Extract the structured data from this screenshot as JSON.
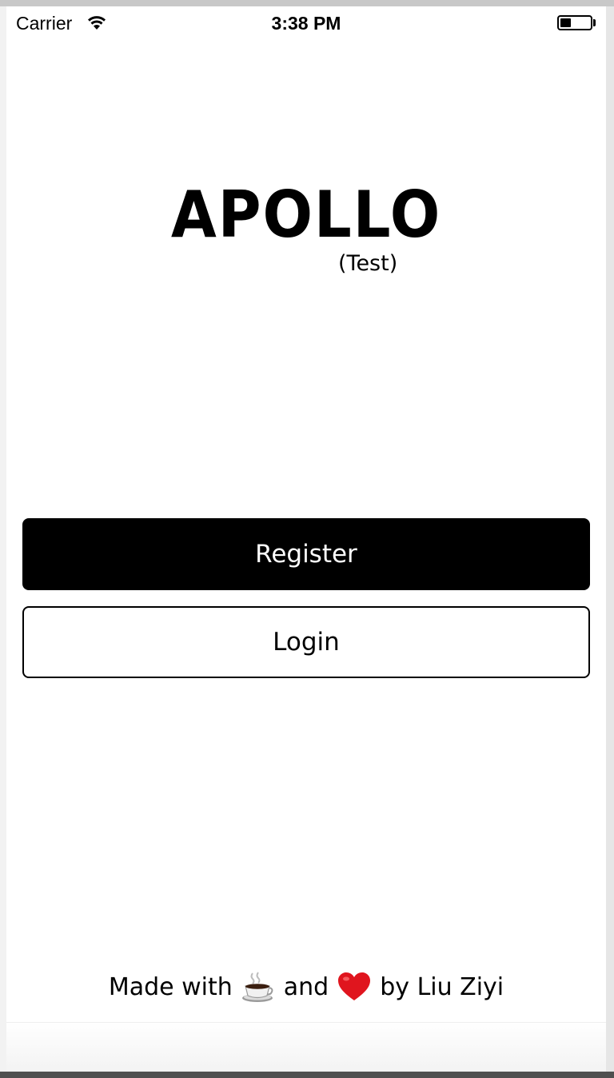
{
  "status_bar": {
    "carrier": "Carrier",
    "time": "3:38 PM",
    "battery_level_fraction": 0.35
  },
  "logo": {
    "title": "APOLLO",
    "subtitle": "(Test)"
  },
  "actions": {
    "register_label": "Register",
    "login_label": "Login"
  },
  "footer": {
    "made_with": "Made with",
    "coffee_icon": "coffee-icon",
    "and": "and",
    "heart_icon": "heart-icon",
    "by": "by Liu Ziyi"
  },
  "colors": {
    "primary": "#000000",
    "background": "#ffffff",
    "heart": "#e0151e"
  }
}
